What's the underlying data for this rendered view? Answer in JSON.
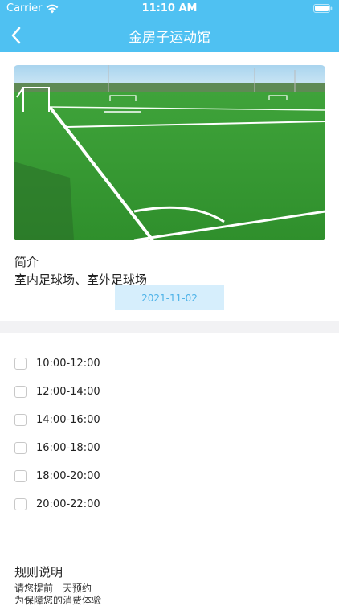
{
  "status_bar": {
    "carrier": "Carrier",
    "time": "11:10 AM"
  },
  "nav": {
    "title": "金房子运动馆",
    "back_icon": "chevron-left-icon"
  },
  "venue": {
    "photo": "football-pitch-photo",
    "intro_heading": "简介",
    "intro_text": "室内足球场、室外足球场"
  },
  "date": {
    "selected": "2021-11-02"
  },
  "slots": [
    {
      "label": "10:00-12:00",
      "checked": false
    },
    {
      "label": "12:00-14:00",
      "checked": false
    },
    {
      "label": "14:00-16:00",
      "checked": false
    },
    {
      "label": "16:00-18:00",
      "checked": false
    },
    {
      "label": "18:00-20:00",
      "checked": false
    },
    {
      "label": "20:00-22:00",
      "checked": false
    }
  ],
  "rules": {
    "heading": "规则说明",
    "lines": [
      "请您提前一天预约",
      "为保障您的消费体验"
    ]
  },
  "colors": {
    "header": "#4fc1f2",
    "date_pill_bg": "#d6eefc",
    "date_pill_text": "#4fb3e8",
    "divider": "#f2f2f4"
  }
}
